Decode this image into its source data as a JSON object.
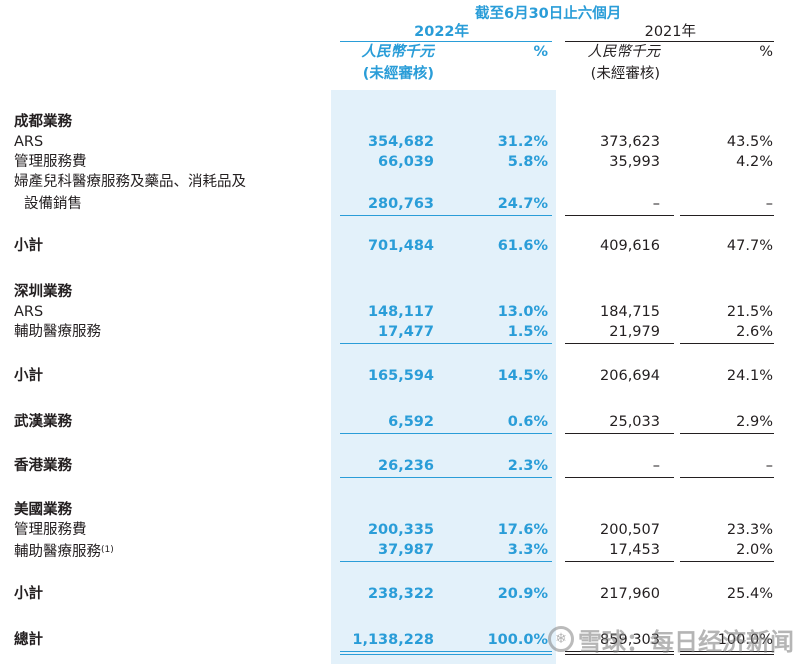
{
  "header": {
    "period": "截至6月30日止六個月",
    "year_2022": "2022年",
    "year_2021": "2021年",
    "currency": "人民幣千元",
    "unaudited": "(未經審核)",
    "pct": "%"
  },
  "rows": [
    {
      "label": "成都業務",
      "bold": true
    },
    {
      "label": "ARS",
      "v2022": "354,682",
      "p2022": "31.2%",
      "v2021": "373,623",
      "p2021": "43.5%"
    },
    {
      "label": "管理服務費",
      "v2022": "66,039",
      "p2022": "5.8%",
      "v2021": "35,993",
      "p2021": "4.2%"
    },
    {
      "label": "婦產兒科醫療服務及藥品、消耗品及"
    },
    {
      "label": "設備銷售",
      "v2022": "280,763",
      "p2022": "24.7%",
      "v2021": "–",
      "p2021": "–"
    },
    {
      "label": "小計",
      "bold": true,
      "v2022": "701,484",
      "p2022": "61.6%",
      "v2021": "409,616",
      "p2021": "47.7%"
    },
    {
      "label": "深圳業務",
      "bold": true
    },
    {
      "label": "ARS",
      "v2022": "148,117",
      "p2022": "13.0%",
      "v2021": "184,715",
      "p2021": "21.5%"
    },
    {
      "label": "輔助醫療服務",
      "v2022": "17,477",
      "p2022": "1.5%",
      "v2021": "21,979",
      "p2021": "2.6%"
    },
    {
      "label": "小計",
      "bold": true,
      "v2022": "165,594",
      "p2022": "14.5%",
      "v2021": "206,694",
      "p2021": "24.1%"
    },
    {
      "label": "武漢業務",
      "bold": true,
      "v2022": "6,592",
      "p2022": "0.6%",
      "v2021": "25,033",
      "p2021": "2.9%"
    },
    {
      "label": "香港業務",
      "bold": true,
      "v2022": "26,236",
      "p2022": "2.3%",
      "v2021": "–",
      "p2021": "–"
    },
    {
      "label": "美國業務",
      "bold": true
    },
    {
      "label": "管理服務費",
      "v2022": "200,335",
      "p2022": "17.6%",
      "v2021": "200,507",
      "p2021": "23.3%"
    },
    {
      "label": "輔助醫療服務",
      "note": "(1)",
      "v2022": "37,987",
      "p2022": "3.3%",
      "v2021": "17,453",
      "p2021": "2.0%"
    },
    {
      "label": "小計",
      "bold": true,
      "v2022": "238,322",
      "p2022": "20.9%",
      "v2021": "217,960",
      "p2021": "25.4%"
    },
    {
      "label": "總計",
      "bold": true,
      "v2022": "1,138,228",
      "p2022": "100.0%",
      "v2021": "859,303",
      "p2021": "100.0%"
    }
  ],
  "watermark": {
    "logo": "❄",
    "text": "雪球：每日经济新闻"
  }
}
